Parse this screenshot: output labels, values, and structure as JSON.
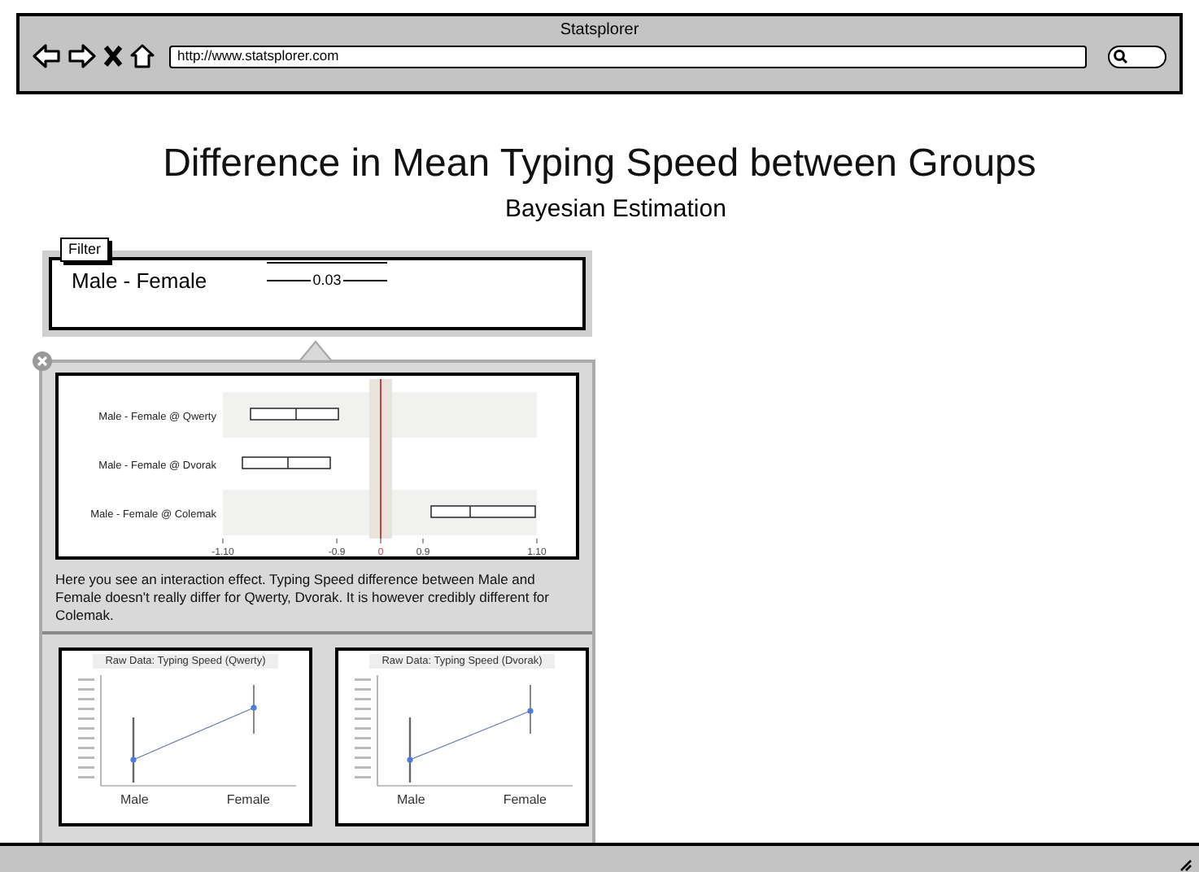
{
  "window": {
    "title": "Statsplorer"
  },
  "browser": {
    "url": "http://www.statsplorer.com"
  },
  "page": {
    "title": "Difference in Mean Typing Speed between Groups",
    "subtitle": "Bayesian Estimation"
  },
  "filter_button": {
    "label": "Filter"
  },
  "summary_card": {
    "label": "Male - Female",
    "value": "0.03"
  },
  "popover": {
    "forest_plot": {
      "rows": [
        "Male - Female @ Qwerty",
        "Male - Female @ Dvorak",
        "Male - Female @ Colemak"
      ],
      "axis_ticks": [
        "-1.10",
        "-0.9",
        "0",
        "0.9",
        "1.10"
      ]
    },
    "description": "Here you see an interaction effect. Typing Speed difference between Male and Female doesn't really differ for Qwerty, Dvorak. It is however credibly different for Colemak.",
    "raw_plots": [
      {
        "title": "Raw Data: Typing Speed (Qwerty)",
        "groups": [
          "Male",
          "Female"
        ]
      },
      {
        "title": "Raw Data: Typing Speed (Dvorak)",
        "groups": [
          "Male",
          "Female"
        ]
      }
    ]
  }
}
